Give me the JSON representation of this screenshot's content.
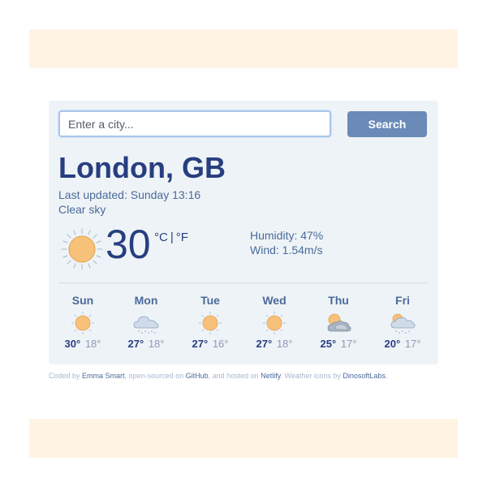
{
  "search": {
    "placeholder": "Enter a city...",
    "value": "",
    "button_label": "Search"
  },
  "current": {
    "city": "London, GB",
    "last_updated": "Last updated: Sunday 13:16",
    "description": "Clear sky",
    "temperature": "30",
    "unit_celsius": "°C",
    "unit_separator": "|",
    "unit_fahrenheit": "°F",
    "humidity": "Humidity: 47%",
    "wind": "Wind: 1.54m/s",
    "icon": "clear-sky-sun-icon"
  },
  "forecast": [
    {
      "day": "Sun",
      "max": "30°",
      "min": "18°",
      "icon": "clear-sky-sun-icon"
    },
    {
      "day": "Mon",
      "max": "27°",
      "min": "18°",
      "icon": "cloud-rain-icon"
    },
    {
      "day": "Tue",
      "max": "27°",
      "min": "16°",
      "icon": "clear-sky-sun-icon"
    },
    {
      "day": "Wed",
      "max": "27°",
      "min": "18°",
      "icon": "clear-sky-sun-icon"
    },
    {
      "day": "Thu",
      "max": "25°",
      "min": "17°",
      "icon": "sun-behind-clouds-icon"
    },
    {
      "day": "Fri",
      "max": "20°",
      "min": "17°",
      "icon": "sun-cloud-rain-icon"
    }
  ],
  "footer": {
    "coded_by": "Coded by ",
    "author": "Emma Smart",
    "open_sourced": ", open-sourced on ",
    "github": "GitHub",
    "hosted": ", and hosted on ",
    "netlify": "Netlify",
    "icons_by": ". Weather icons by ",
    "dinosoft": "DinosoftLabs",
    "end": "."
  },
  "colors": {
    "accent": "#6a8bb8",
    "title": "#273e80",
    "text": "#4a6a9a",
    "card": "#eef3f7",
    "band": "#fff4e4"
  }
}
